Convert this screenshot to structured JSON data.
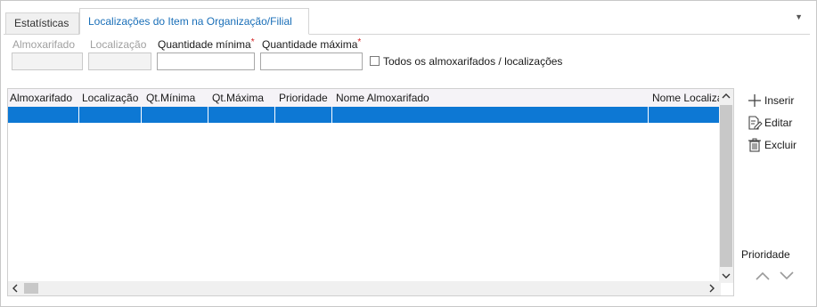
{
  "tabs": [
    {
      "label": "Estatísticas",
      "active": false
    },
    {
      "label": "Localizações do Item na Organização/Filial",
      "active": true
    }
  ],
  "tab_menu_icon": "triangle-down-icon",
  "form": {
    "almoxarifado": {
      "label": "Almoxarifado",
      "value": ""
    },
    "localizacao": {
      "label": "Localização",
      "value": ""
    },
    "qtd_minima": {
      "label": "Quantidade mínima",
      "value": ""
    },
    "qtd_maxima": {
      "label": "Quantidade máxima",
      "value": ""
    },
    "required_mark": "*",
    "todos_label": "Todos os almoxarifados / localizações"
  },
  "grid": {
    "columns": [
      "Almoxarifado",
      "Localização",
      "Qt.Mínima",
      "Qt.Máxima",
      "Prioridade",
      "Nome Almoxarifado",
      "Nome Localiza"
    ],
    "rows": [
      [
        "",
        "",
        "",
        "",
        "",
        "",
        ""
      ]
    ],
    "selected_color": "#0d78d4"
  },
  "actions": {
    "inserir": "Inserir",
    "editar": "Editar",
    "excluir": "Excluir"
  },
  "priority": {
    "label": "Prioridade",
    "up_icon": "chevron-up-icon",
    "down_icon": "chevron-down-icon"
  },
  "colors": {
    "accent": "#1a6fb8",
    "required": "#d42020"
  }
}
